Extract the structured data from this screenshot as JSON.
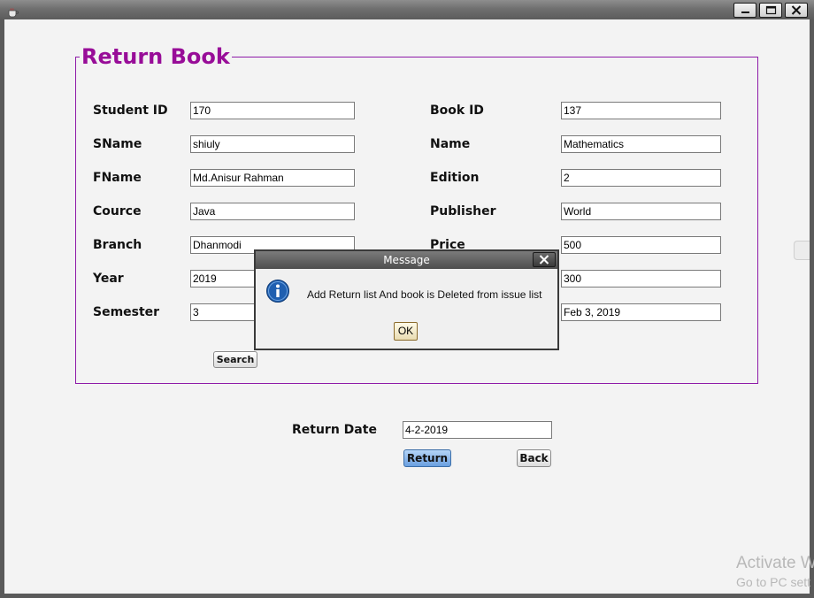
{
  "window": {
    "icon": "java-cup-icon",
    "controls": [
      "minimize-icon",
      "maximize-icon",
      "close-icon"
    ]
  },
  "form": {
    "title": "Return Book",
    "student": [
      {
        "label": "Student ID",
        "value": "170"
      },
      {
        "label": "SName",
        "value": "shiuly"
      },
      {
        "label": "FName",
        "value": "Md.Anisur Rahman"
      },
      {
        "label": "Cource",
        "value": "Java"
      },
      {
        "label": "Branch",
        "value": "Dhanmodi"
      },
      {
        "label": "Year",
        "value": "2019"
      },
      {
        "label": "Semester",
        "value": "3"
      }
    ],
    "book": [
      {
        "label": "Book ID",
        "value": "137"
      },
      {
        "label": "Name",
        "value": "Mathematics"
      },
      {
        "label": "Edition",
        "value": "2"
      },
      {
        "label": "Publisher",
        "value": "World"
      },
      {
        "label": "Price",
        "value": "500"
      },
      {
        "label": "",
        "value": "300"
      },
      {
        "label": "",
        "value": "Feb 3, 2019"
      }
    ],
    "search_label": "Search"
  },
  "return": {
    "label": "Return Date",
    "value": "4-2-2019",
    "return_button": "Return",
    "back_button": "Back"
  },
  "dialog": {
    "title": "Message",
    "icon": "info-icon",
    "message": "Add Return list And book is Deleted from issue list",
    "ok_label": "OK"
  },
  "watermark": {
    "line1": "Activate W",
    "line2": "Go to PC sett"
  },
  "colors": {
    "accent": "#980d98",
    "primary_button": "#6a9fe0"
  }
}
